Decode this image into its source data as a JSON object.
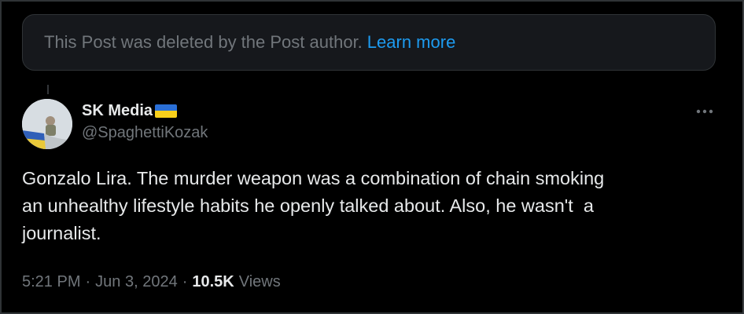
{
  "deleted_notice": {
    "text": "This Post was deleted by the Post author.",
    "link": "Learn more"
  },
  "author": {
    "display_name": "SK Media",
    "handle": "@SpaghettiKozak",
    "flag_icon": "ukraine-flag-icon"
  },
  "post": {
    "text": "Gonzalo Lira. The murder weapon was a combination of chain smoking\nan unhealthy lifestyle habits he openly talked about. Also, he wasn't  a\njournalist."
  },
  "meta": {
    "time": "5:21 PM",
    "separator": "·",
    "date": "Jun 3, 2024",
    "views_count": "10.5K",
    "views_label": "Views"
  },
  "colors": {
    "background": "#000000",
    "text_primary": "#e7e9ea",
    "text_secondary": "#71767b",
    "link": "#1d9bf0",
    "notice_bg": "#16181c",
    "border": "#2f3336"
  },
  "icons": {
    "more": "more-horizontal-icon"
  }
}
